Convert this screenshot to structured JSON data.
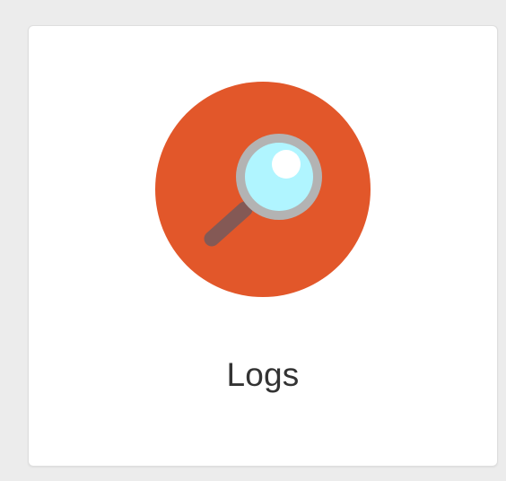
{
  "tile": {
    "label": "Logs",
    "icon": "magnifying-glass-icon",
    "colors": {
      "circle": "#e2572a",
      "lens_rim": "#b3b3b3",
      "lens_glass": "#b0f5ff",
      "lens_shine": "#ffffff",
      "handle": "#7a5a5a"
    }
  }
}
